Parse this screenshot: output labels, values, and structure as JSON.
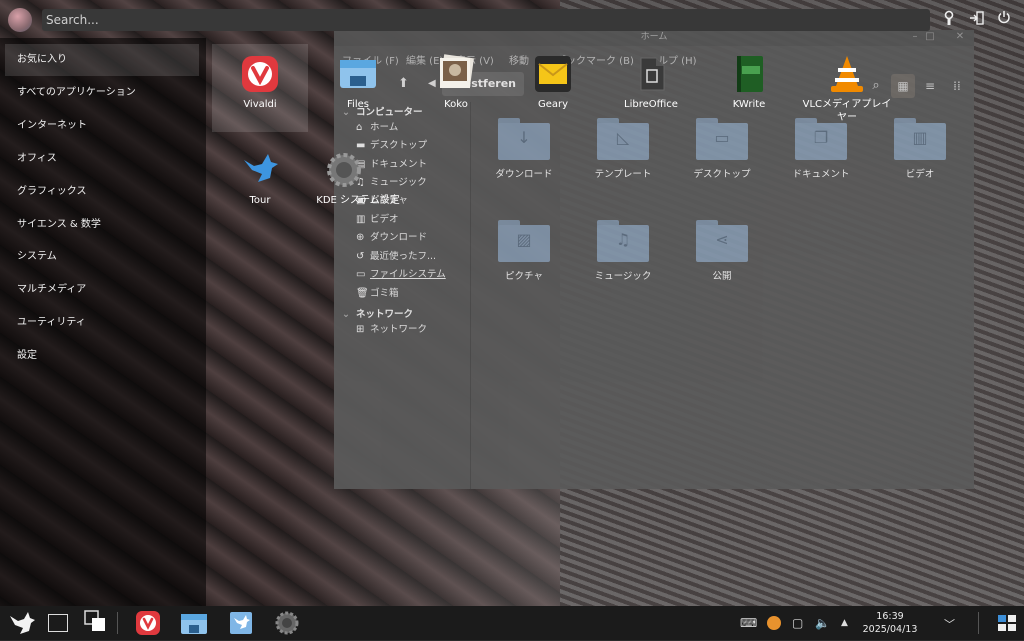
{
  "search": {
    "placeholder": "Search..."
  },
  "categories": [
    {
      "label": "お気に入り"
    },
    {
      "label": "すべてのアプリケーション"
    },
    {
      "label": "インターネット"
    },
    {
      "label": "オフィス"
    },
    {
      "label": "グラフィックス"
    },
    {
      "label": "サイエンス & 数学"
    },
    {
      "label": "システム"
    },
    {
      "label": "マルチメディア"
    },
    {
      "label": "ユーティリティ"
    },
    {
      "label": "設定"
    }
  ],
  "favorites": [
    {
      "label": "Vivaldi",
      "icon": "vivaldi-icon"
    },
    {
      "label": "Files",
      "icon": "files-icon"
    },
    {
      "label": "Koko",
      "icon": "koko-icon"
    },
    {
      "label": "Geary",
      "icon": "geary-icon"
    },
    {
      "label": "LibreOffice",
      "icon": "libreoffice-icon"
    },
    {
      "label": "KWrite",
      "icon": "kwrite-icon"
    },
    {
      "label": "VLCメディアプレイヤー",
      "icon": "vlc-icon"
    },
    {
      "label": "Tour",
      "icon": "tour-icon"
    },
    {
      "label": "KDE システム設定",
      "icon": "kde-settings-icon"
    }
  ],
  "filemanager": {
    "title": "ホーム",
    "menus": [
      "ファイル (F)",
      "編集 (E)",
      "表示 (V)",
      "移動",
      "ブックマーク (B)",
      "ヘルプ (H)"
    ],
    "path_label": "nestferen",
    "sidebar": {
      "computer_header": "コンピューター",
      "items": [
        "ホーム",
        "デスクトップ",
        "ドキュメント",
        "ミュージック",
        "ピクチャ",
        "ビデオ",
        "ダウンロード",
        "最近使ったフ...",
        "ファイルシステム",
        "ゴミ箱"
      ],
      "network_header": "ネットワーク",
      "network_items": [
        "ネットワーク"
      ]
    },
    "folders": [
      "ダウンロード",
      "テンプレート",
      "デスクトップ",
      "ドキュメント",
      "ビデオ",
      "ピクチャ",
      "ミュージック",
      "公開"
    ]
  },
  "clock": {
    "time": "16:39",
    "date": "2025/04/13"
  },
  "colors": {
    "vivaldi": "#e0393e",
    "files_blue": "#3f8fd8",
    "vlc": "#f18a00",
    "kwrite_green": "#2d7a2d",
    "geary_yellow": "#f5c518",
    "folder": "#8396ab"
  }
}
